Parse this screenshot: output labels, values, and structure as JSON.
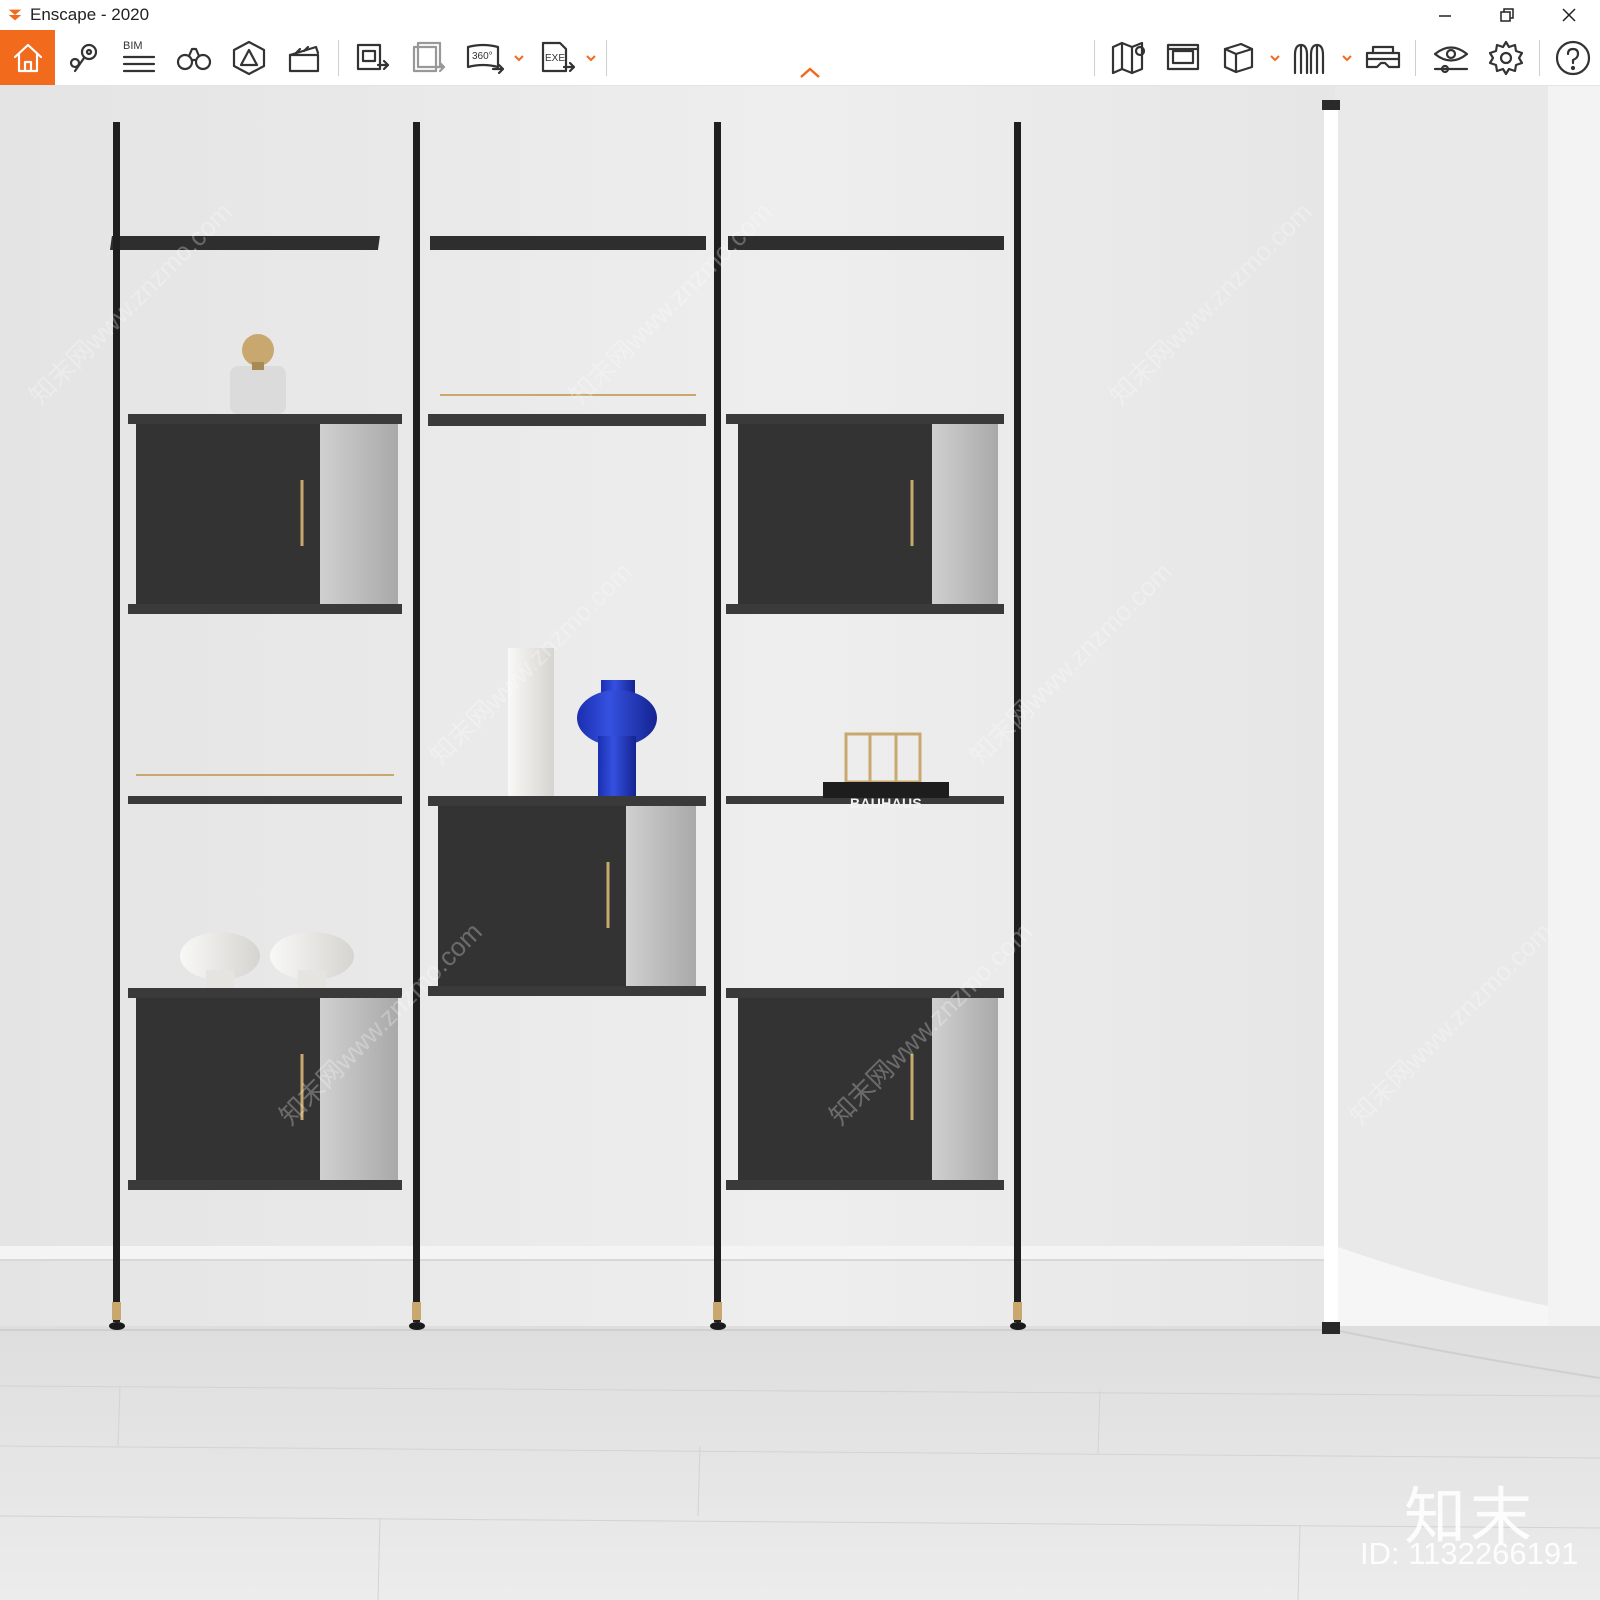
{
  "window": {
    "title": "Enscape - 2020",
    "controls": [
      "minimize",
      "restore",
      "close"
    ]
  },
  "toolbar": {
    "accent": "#f26a1b",
    "groups": [
      [
        "home-icon",
        "location-pins-icon",
        "bim-icon",
        "binoculars-icon",
        "warning-shape-icon",
        "clapperboard-icon"
      ],
      [
        "export-image-icon",
        "batch-render-icon",
        "panorama-360-icon",
        "export-exe-icon"
      ],
      [
        "map-icon",
        "rendering-icon",
        "cube-icon",
        "people-icon",
        "vr-headset-icon"
      ],
      [
        "visual-settings-icon",
        "settings-gear-icon",
        "help-icon"
      ]
    ],
    "bim_label": "BIM",
    "pano_label": "360°",
    "exe_label": "EXE"
  },
  "scene": {
    "book_label": "BAUHAUS",
    "watermark_logo": "知末",
    "watermark_id": "ID: 1132266191",
    "watermark_diag": "知末网www.znzmo.com"
  }
}
